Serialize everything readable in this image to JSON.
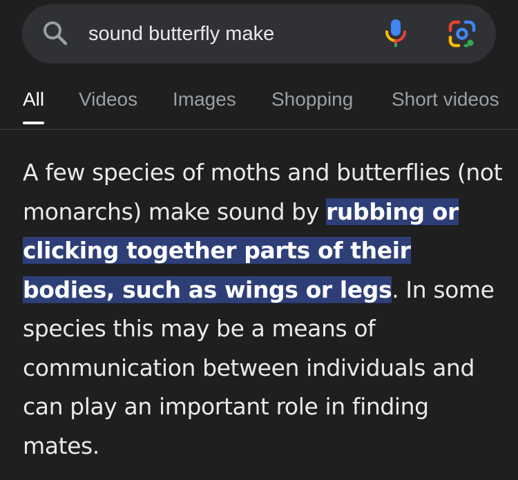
{
  "search": {
    "query": "sound butterfly make",
    "icons": {
      "search": "search-icon",
      "voice": "microphone-icon",
      "lens": "google-lens-icon"
    }
  },
  "tabs": [
    {
      "label": "All",
      "active": true
    },
    {
      "label": "Videos",
      "active": false
    },
    {
      "label": "Images",
      "active": false
    },
    {
      "label": "Shopping",
      "active": false
    },
    {
      "label": "Short videos",
      "active": false
    }
  ],
  "snippet": {
    "text_before": "A few species of moths and butterflies (not monarchs) make sound by ",
    "text_highlighted": "rubbing or clicking together parts of their bodies, such as wings or legs",
    "text_after": ". In some species this may be a means of communication between individuals and can play an important role in finding mates."
  },
  "colors": {
    "background": "#1f1f1f",
    "search_bar": "#303134",
    "highlight": "#2e3f78",
    "google_blue": "#4285f4",
    "google_red": "#ea4335",
    "google_yellow": "#fbbc05",
    "google_green": "#34a853"
  }
}
